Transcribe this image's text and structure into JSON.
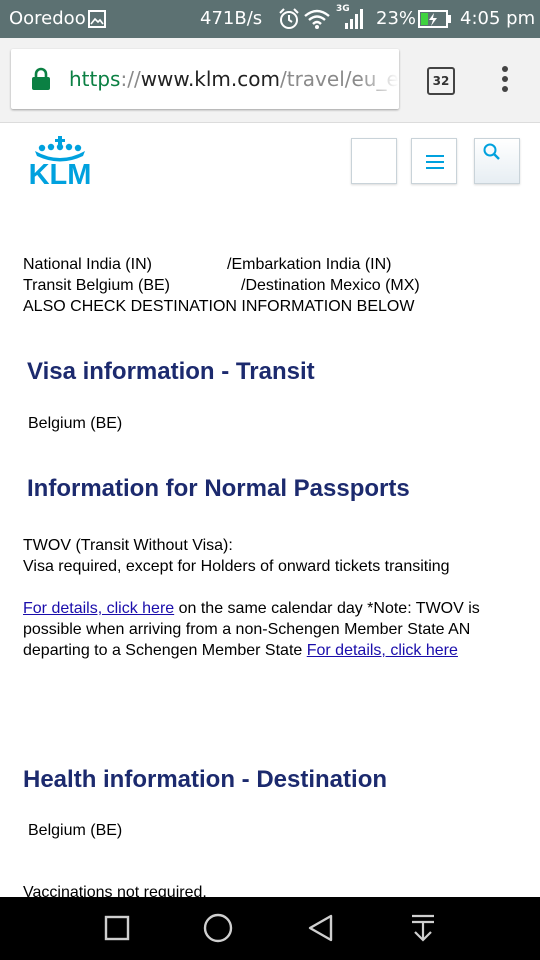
{
  "status_bar": {
    "carrier": "Ooredoo",
    "speed": "471B/s",
    "network": "3G",
    "battery": "23%",
    "time": "4:05 pm"
  },
  "browser": {
    "url_scheme": "https",
    "url_separator": "://",
    "url_host": "www.klm.com",
    "url_path": "/travel/eu_en",
    "tab_count": "32"
  },
  "header": {
    "logo_text": "KLM"
  },
  "content": {
    "line1a": "National India (IN)",
    "line1b": "/Embarkation India (IN)",
    "line2a": "Transit Belgium (BE)",
    "line2b": "/Destination Mexico (MX)",
    "line3": "ALSO CHECK DESTINATION INFORMATION BELOW",
    "visa_heading": "Visa information - Transit",
    "visa_country": "Belgium (BE)",
    "normal_heading": "Information for Normal Passports",
    "twov_title": "TWOV (Transit Without Visa):",
    "twov_text": "Visa required, except for Holders of onward tickets transiting",
    "details_link_1": "For details, click here",
    "note_line1_rest": " on the same calendar day *Note: TWOV is",
    "note_line2": "possible when arriving from a non-Schengen Member State AN",
    "note_line3_start": "departing to a Schengen Member State ",
    "details_link_2": "For details, click here",
    "health_heading": "Health information - Destination",
    "health_country": "Belgium (BE)",
    "vaccinations": "Vaccinations not required."
  },
  "colors": {
    "status_bar": "#5c7172",
    "klm_blue": "#00a1de",
    "heading_navy": "#1c2a6e",
    "link": "#1a0dab",
    "secure_green": "#0b8043"
  },
  "icons": [
    "gallery-icon",
    "alarm-icon",
    "wifi-icon",
    "signal-icon",
    "battery-icon",
    "lock-icon",
    "tabs-icon",
    "menu-icon",
    "klm-crown-icon",
    "hamburger-icon",
    "search-icon",
    "recent-apps-icon",
    "home-icon",
    "back-icon",
    "notifications-down-icon"
  ]
}
